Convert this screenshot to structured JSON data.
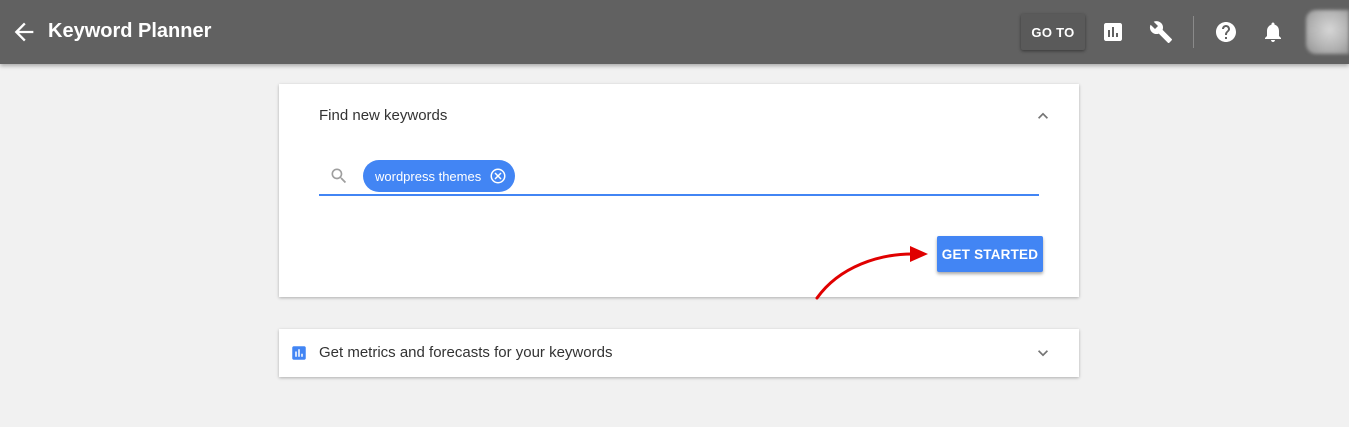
{
  "header": {
    "title": "Keyword Planner",
    "goto_label": "GO TO",
    "icons": [
      "back-arrow-icon",
      "reports-icon",
      "wrench-icon",
      "help-icon",
      "notifications-bell-icon"
    ]
  },
  "find_keywords": {
    "title": "Find new keywords",
    "keyword_chip": "wordpress themes",
    "button_label": "GET STARTED",
    "expanded": true
  },
  "metrics": {
    "title": "Get metrics and forecasts for your keywords",
    "expanded": false
  },
  "colors": {
    "header_bg": "#616161",
    "accent_blue": "#4285f4",
    "annotation_red": "#e00000",
    "page_bg": "#f1f1f1"
  }
}
